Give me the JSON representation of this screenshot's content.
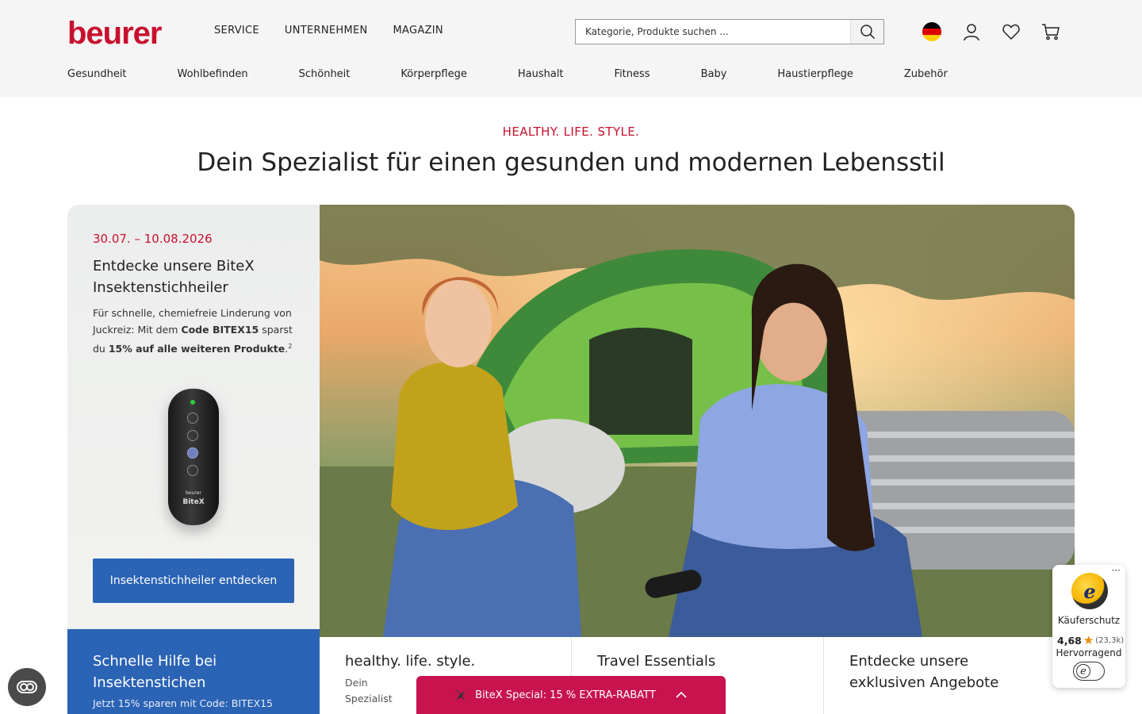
{
  "brand": {
    "logo_text": "beurer",
    "accent_color": "#c8102e",
    "button_blue": "#2b63b5",
    "promo_bar_color": "#c8134f"
  },
  "top_nav": [
    "SERVICE",
    "UNTERNEHMEN",
    "MAGAZIN"
  ],
  "search": {
    "placeholder": "Kategorie, Produkte suchen ...",
    "icon": "search-icon"
  },
  "header_icons": [
    "flag-de-icon",
    "user-icon",
    "heart-icon",
    "cart-icon"
  ],
  "categories": [
    "Gesundheit",
    "Wohlbefinden",
    "Schönheit",
    "Körperpflege",
    "Haushalt",
    "Fitness",
    "Baby",
    "Haustierpflege",
    "Zubehör"
  ],
  "hero": {
    "kicker": "HEALTHY. LIFE. STYLE.",
    "headline": "Dein Spezialist für einen gesunden und modernen Lebensstil"
  },
  "promo": {
    "date": "30.07. – 10.08.2026",
    "title": "Entdecke unsere BiteX Insektenstichheiler",
    "text_1": "Für schnelle, chemiefreie Linderung von Juckreiz: Mit dem ",
    "code_text": "Code BITEX15",
    "text_2": " sparst du ",
    "discount_text": "15% auf alle weiteren Produkte",
    "text_3": ".",
    "footnote": "2",
    "device_brand": "beurer",
    "device_model": "BiteX",
    "button_label": "Insektenstichheiler entdecken"
  },
  "tiles": [
    {
      "title": "Schnelle Hilfe bei Insektenstichen",
      "subtitle": "Jetzt 15% sparen mit Code: BITEX15"
    },
    {
      "title": "healthy. life. style.",
      "subtitle": "Dein Spezialist Wohlbefinden"
    },
    {
      "title": "Travel Essentials",
      "subtitle": ""
    },
    {
      "title": "Entdecke unsere exklusiven Angebote",
      "subtitle": ""
    }
  ],
  "promo_bar": {
    "label": "BiteX Special: 15 % EXTRA-RABATT",
    "icon": "mosquito-icon",
    "toggle_icon": "chevron-up-icon"
  },
  "trusted_shops": {
    "label": "Käuferschutz",
    "rating": "4,68",
    "count": "(23,3k)",
    "verdict": "Hervorragend",
    "seal_letter": "e",
    "more": "···"
  },
  "accessibility_icon": "accessibility-icon"
}
